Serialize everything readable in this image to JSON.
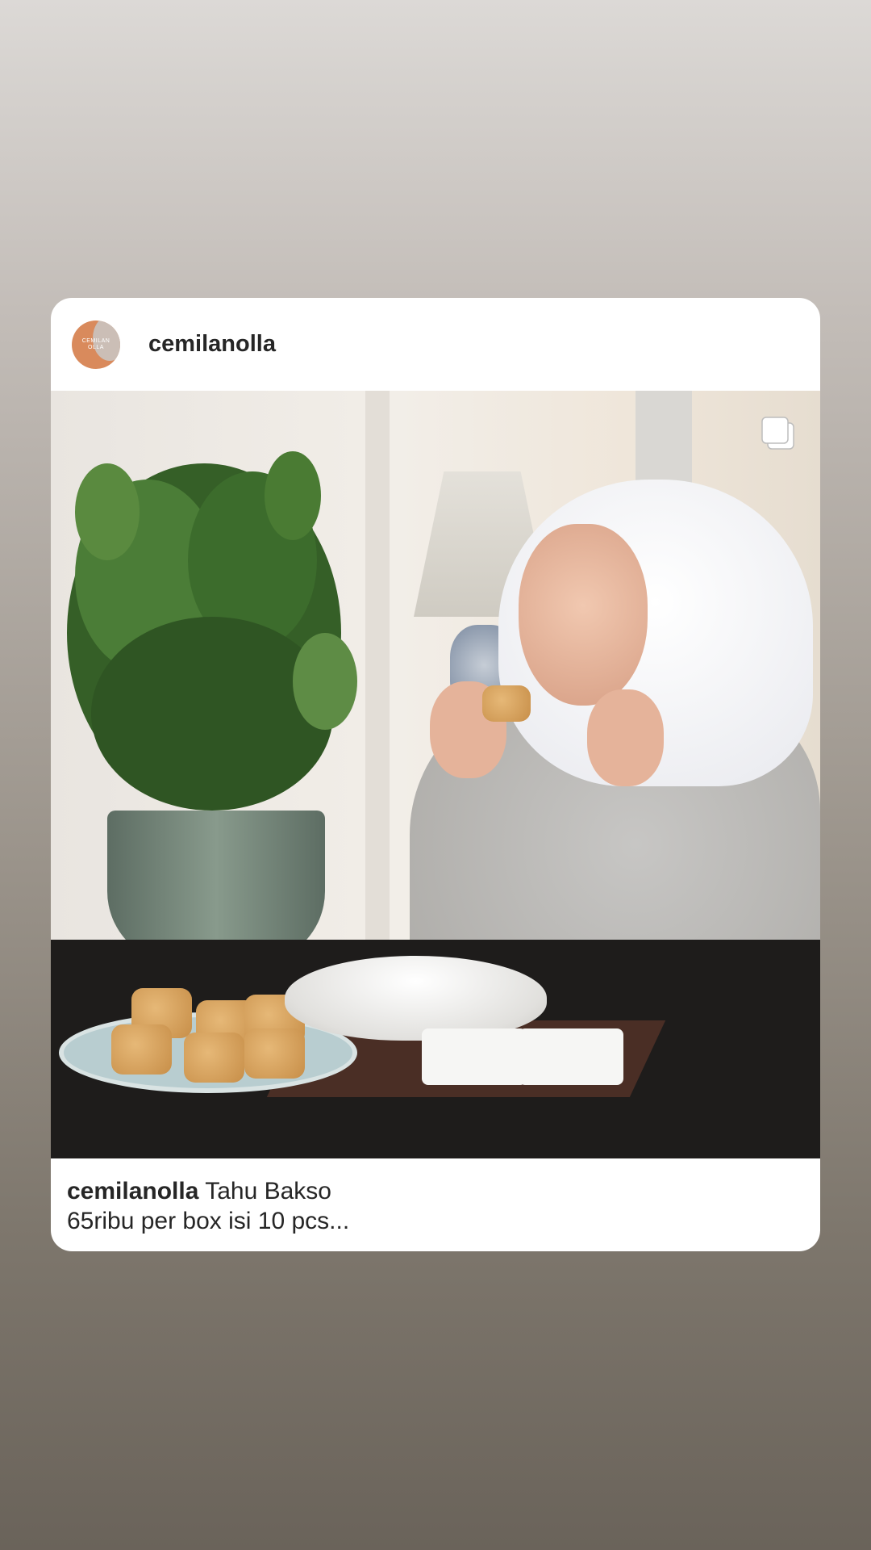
{
  "post": {
    "username": "cemilanolla",
    "avatar_text_line1": "CEMILAN",
    "avatar_text_line2": "OLLA",
    "caption_user": "cemilanolla",
    "caption_line1": "Tahu Bakso",
    "caption_line2": "65ribu per box isi 10 pcs...",
    "media_type_icon": "multiple-photos-icon"
  },
  "colors": {
    "card_background": "#ffffff",
    "text_primary": "#262626",
    "avatar_brand": "#d98a5c"
  }
}
